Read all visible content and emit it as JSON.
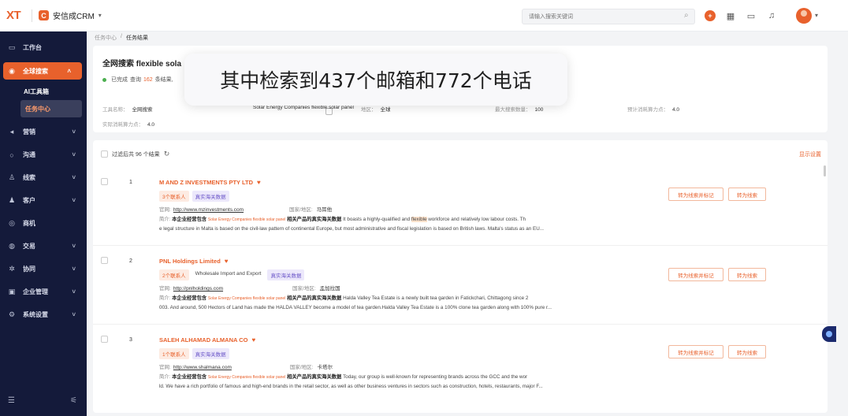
{
  "header": {
    "logo": "XT",
    "brand_name": "安信成CRM",
    "search_placeholder": "请输入搜索关键词",
    "icons": [
      "search-icon",
      "plus-circle-icon",
      "calendar-icon",
      "inbox-icon",
      "bell-icon",
      "avatar"
    ]
  },
  "sidebar": {
    "items": [
      {
        "label": "工作台",
        "icon": "monitor-icon",
        "chevron": false
      },
      {
        "label": "全球搜索",
        "icon": "globe-icon",
        "chevron": true,
        "active": true
      },
      {
        "label": "营销",
        "icon": "megaphone-icon",
        "chevron": true
      },
      {
        "label": "沟通",
        "icon": "chat-icon",
        "chevron": true
      },
      {
        "label": "线索",
        "icon": "lead-icon",
        "chevron": true
      },
      {
        "label": "客户",
        "icon": "user-icon",
        "chevron": true
      },
      {
        "label": "商机",
        "icon": "opportunity-icon",
        "chevron": false
      },
      {
        "label": "交易",
        "icon": "deal-icon",
        "chevron": true
      },
      {
        "label": "协同",
        "icon": "cooperation-icon",
        "chevron": true
      },
      {
        "label": "企业管理",
        "icon": "building-icon",
        "chevron": true
      },
      {
        "label": "系统设置",
        "icon": "settings-icon",
        "chevron": true
      }
    ],
    "subitems": [
      {
        "label": "AI工具箱"
      },
      {
        "label": "任务中心",
        "selected": true
      }
    ]
  },
  "breadcrumb": {
    "parent": "任务中心",
    "separator": "/",
    "current": "任务结果"
  },
  "summary": {
    "title": "全网搜索 flexible sola",
    "status_prefix": "已完成",
    "status_mid": "查询",
    "status_count": "162",
    "status_suffix": "条结果,",
    "tool_label": "工具名称：",
    "tool_value": "全网搜索",
    "keyword_value": "Solar Energy Companies flexible solar panel",
    "region_label": "地区：",
    "region_value": "全球",
    "count_label": "最大搜索数量：",
    "count_value": "100",
    "est_label": "预计消耗算力点：",
    "est_value": "4.0",
    "actual_label": "实际消耗算力点：",
    "actual_value": "4.0"
  },
  "toast": {
    "text": "其中检索到437个邮箱和772个电话"
  },
  "results": {
    "header": "过滤后共 96 个结果",
    "settings_label": "显示设置",
    "website_label": "官网:",
    "country_label": "国家/地区:",
    "intro_label": "简介:",
    "contains_label": "本企业经营包含",
    "keyword_tag": "Solar Energy Companies flexible solar panel",
    "related_label": "相关产品的真实海关数据",
    "btn_convert_mark": "转为线索并标记",
    "btn_convert": "转为线索",
    "rows": [
      {
        "index": "1",
        "name": "M AND Z INVESTMENTS PTY LTD",
        "contacts": "3个联系人",
        "industry": "",
        "customs": "真实海关数据",
        "website": "http://www.mzinvestments.com",
        "country": "马耳他",
        "intro_pre": " It boasts a highly-qualified and ",
        "intro_hl": "flexible",
        "intro_post": " workforce and relatively low labour costs. Th",
        "intro_line2": "e legal structure in Malta is based on the civil-law pattern of continental Europe, but most administrative and fiscal legislation is based on British laws. Malta's status as an EU..."
      },
      {
        "index": "2",
        "name": "PNL Holdings Limited",
        "contacts": "2个联系人",
        "industry": "Wholesale Import and Export",
        "customs": "真实海关数据",
        "website": "http://pnlholdings.com",
        "country": "孟加拉国",
        "intro_pre": " Halda Valley Tea Estate is a newly built tea garden in Fatickchari, Chittagong since 2",
        "intro_hl": "",
        "intro_post": "",
        "intro_line2": "003. And around, 500 Hectors of Land has made the HALDA VALLEY become a model of tea garden.Halda Valley Tea Estate is a 100% clone tea garden along with 100% pure r..."
      },
      {
        "index": "3",
        "name": "SALEH ALHAMAD ALMANA CO",
        "contacts": "1个联系人",
        "industry": "",
        "customs": "真实海关数据",
        "website": "http://www.shalmana.com",
        "country": "卡塔尔",
        "intro_pre": " Today, our group is well-known for representing brands across the GCC and the wor",
        "intro_hl": "",
        "intro_post": "",
        "intro_line2": "ld. We have a rich portfolio of famous and high-end brands in the retail sector, as well as other business ventures in sectors such as construction, hotels, restaurants, major F..."
      }
    ]
  },
  "colors": {
    "accent": "#e8612c",
    "sidebar_bg": "#141a3a",
    "tag_purple": "#6a55c8"
  }
}
